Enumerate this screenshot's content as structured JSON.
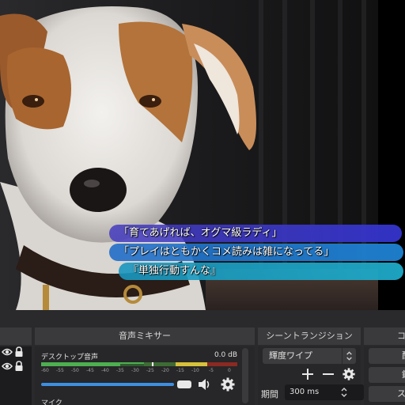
{
  "preview": {
    "comments": [
      "「育てあげれば、オグマ級ラディ」",
      "「プレイはともかくコメ読みは雑になってる」",
      "『単独行動すんな』"
    ]
  },
  "dock": {
    "mixer": {
      "title": "音声ミキサー",
      "tracks": [
        {
          "name": "デスクトップ音声",
          "db": "0.0 dB"
        },
        {
          "name": "マイク",
          "db": ""
        }
      ],
      "scale_ticks": [
        "-60",
        "-55",
        "-50",
        "-45",
        "-40",
        "-35",
        "-30",
        "-25",
        "-20",
        "-15",
        "-10",
        "-5",
        "0"
      ]
    },
    "transitions": {
      "title": "シーントランジション",
      "selected": "輝度ワイプ",
      "period_label": "期間",
      "period_value": "300 ms"
    },
    "controls": {
      "title": "コ",
      "buttons": [
        "配",
        "録",
        "スタ"
      ]
    }
  },
  "colors": {
    "comment1": "#3434cd",
    "comment2": "#1e82d2",
    "comment3": "#1eaac8",
    "meter_green": "#4caf50",
    "meter_yellow": "#d6c13a",
    "meter_red": "#c0392b",
    "slider_blue": "#3d8fe0"
  }
}
